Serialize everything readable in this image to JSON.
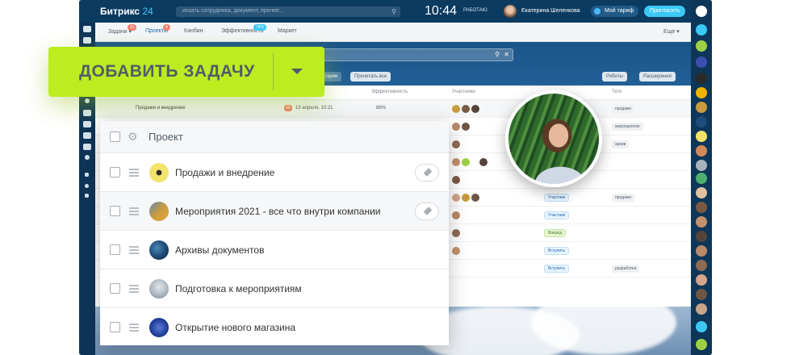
{
  "topbar": {
    "logo_main": "Битрикс",
    "logo_num": "24",
    "search_placeholder": "искать сотрудника, документ, прочее...",
    "clock": "10:44",
    "work_status": "РАБОТАЮ",
    "user_name": "Екатерина Шеленкова",
    "tariff": "Мой тариф",
    "invite": "Пригласить",
    "help": "?"
  },
  "tabs": [
    {
      "label": "Задачи",
      "badge": "11"
    },
    {
      "label": "Проекты",
      "badge": "4"
    },
    {
      "label": "Канбан",
      "badge": ""
    },
    {
      "label": "Эффективность",
      "badge": "76%"
    },
    {
      "label": "Маркет",
      "badge": ""
    },
    {
      "label": "Еще",
      "badge": ""
    }
  ],
  "toolbar": {
    "comments": "нтарии",
    "read_all": "Прочитать все",
    "robots": "Роботы",
    "extensions": "Расширения"
  },
  "grid": {
    "headers": {
      "efficiency": "Эффективность",
      "participants": "Участники",
      "tags": "Теги"
    },
    "first_row": {
      "name": "Продажи и внедрение",
      "badge": "35",
      "deadline": "19 апреля, 10:21",
      "efficiency": "86%"
    },
    "participant_tags": [
      "Участник",
      "Участник",
      "Вперёд",
      "Вступить",
      "Вступить"
    ],
    "tags": [
      "продажи",
      "мероприятия",
      "архив",
      "продажи",
      "разработка"
    ]
  },
  "add_task": {
    "label": "ДОБАВИТЬ ЗАДАЧУ"
  },
  "dropdown": {
    "header": "Проект",
    "projects": [
      {
        "name": "Продажи и внедрение",
        "pinned": true,
        "color": "#f2e36b"
      },
      {
        "name": "Мероприятия 2021 - все что внутри компании",
        "pinned": true,
        "color": "#c99a3f"
      },
      {
        "name": "Архивы документов",
        "pinned": false,
        "color": "#1e4d7a"
      },
      {
        "name": "Подготовка к мероприятиям",
        "pinned": false,
        "color": "#a9b3bd"
      },
      {
        "name": "Открытие нового магазина",
        "pinned": false,
        "color": "#1f3f9a"
      }
    ]
  }
}
